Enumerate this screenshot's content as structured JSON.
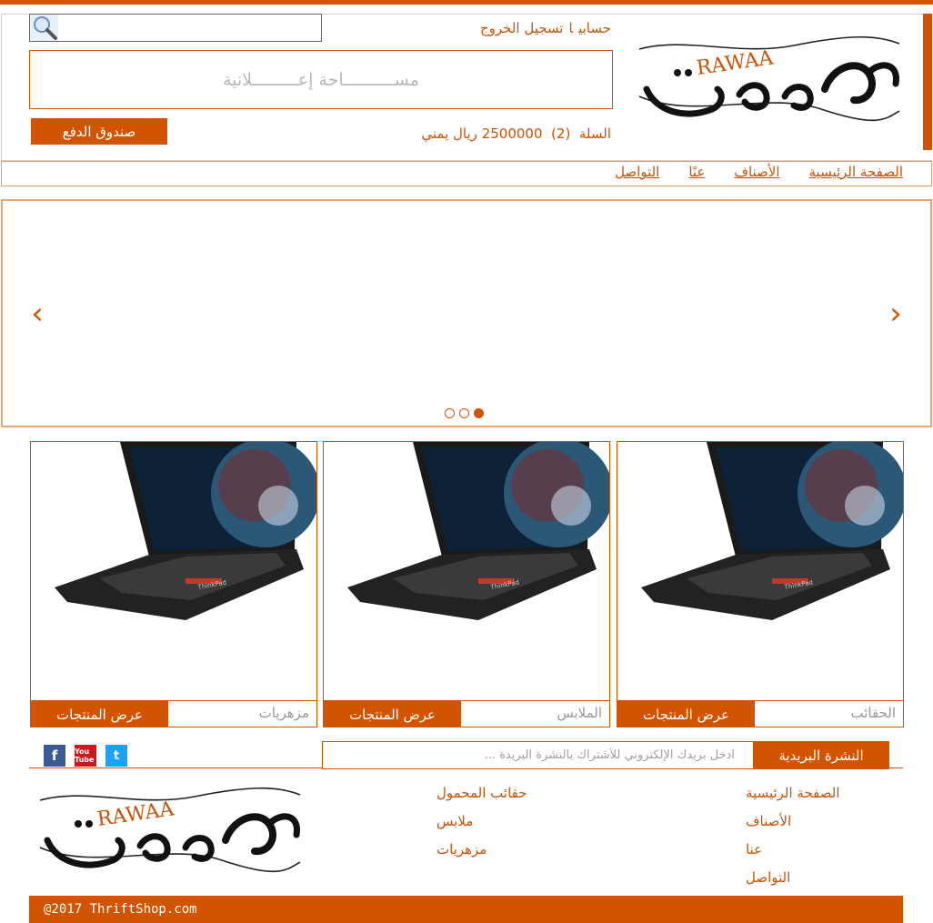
{
  "header": {
    "logo_text": "RAWAA",
    "account_link": "حسابي",
    "account_separator": "ا",
    "logout_link": "تسجيل الخروج",
    "ad_space": "مســــــــــاحة إعـــــــــلانية",
    "checkout_button": "صندوق الدفع",
    "cart_label": "السلة",
    "cart_count": "(2)",
    "cart_total": "2500000 ريال يمني"
  },
  "search": {
    "placeholder": ""
  },
  "nav": {
    "home": "الصفحة الرئيسية",
    "categories": "الأصناف",
    "about": "عنًا",
    "contact": "التواصل"
  },
  "slider": {
    "prev_icon": "chevron-left-icon",
    "next_icon": "chevron-right-icon",
    "dots_count": 3,
    "active_dot": 3
  },
  "products": [
    {
      "category": "الحقائب",
      "button": "عرض المنتجات",
      "image": "laptop"
    },
    {
      "category": "الملابس",
      "button": "عرض المنتجات",
      "image": "laptop"
    },
    {
      "category": "مزهريات",
      "button": "عرض المنتجات",
      "image": "laptop"
    }
  ],
  "newsletter": {
    "label": "النشرة البريدية",
    "placeholder": "ادخل بريدك الإلكتروني للأشتراك بالنشرة البريدة ..."
  },
  "social": {
    "facebook": "f",
    "youtube": "You Tube",
    "twitter": "t"
  },
  "footer": {
    "logo_text": "RAWAA",
    "col1": [
      "الصفحة الرئيسية",
      "الأصناف",
      "عنا",
      "التواصل"
    ],
    "col2": [
      "حقائب المحمول",
      "ملابس",
      "مزهريات"
    ],
    "copyright": "@2017 ThriftShop.com"
  },
  "colors": {
    "accent": "#d35400",
    "text_accent": "#c85208",
    "muted": "#999999"
  }
}
